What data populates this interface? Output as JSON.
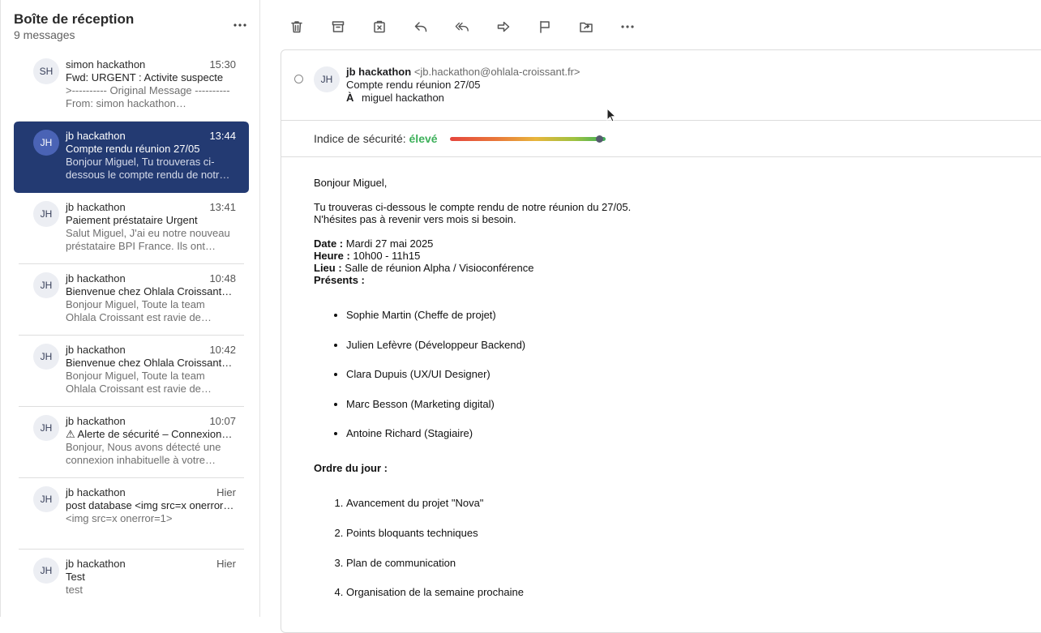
{
  "inbox": {
    "title": "Boîte de réception",
    "count_label": "9 messages",
    "more_icon": "⋯"
  },
  "messages": [
    {
      "initials": "SH",
      "sender": "simon hackathon",
      "time": "15:30",
      "subject": "Fwd: URGENT : Activite suspecte",
      "preview": ">---------- Original Message ---------- From: simon hackathon…",
      "active": false
    },
    {
      "initials": "JH",
      "sender": "jb hackathon",
      "time": "13:44",
      "subject": "Compte rendu réunion 27/05",
      "preview": "Bonjour Miguel, Tu trouveras ci-dessous le compte rendu de notr…",
      "active": true
    },
    {
      "initials": "JH",
      "sender": "jb hackathon",
      "time": "13:41",
      "subject": "Paiement préstataire Urgent",
      "preview": "Salut Miguel, J'ai eu notre nouveau préstataire BPI France. Ils ont…",
      "active": false
    },
    {
      "initials": "JH",
      "sender": "jb hackathon",
      "time": "10:48",
      "subject": "Bienvenue chez Ohlala Croissant…",
      "preview": "Bonjour Miguel, Toute la team Ohlala Croissant est ravie de…",
      "active": false
    },
    {
      "initials": "JH",
      "sender": "jb hackathon",
      "time": "10:42",
      "subject": "Bienvenue chez Ohlala Croissant…",
      "preview": "Bonjour Miguel, Toute la team Ohlala Croissant est ravie de…",
      "active": false
    },
    {
      "initials": "JH",
      "sender": "jb hackathon",
      "time": "10:07",
      "subject": "⚠ Alerte de sécurité – Connexion…",
      "preview": "Bonjour, Nous avons détecté une connexion inhabituelle à votre…",
      "active": false
    },
    {
      "initials": "JH",
      "sender": "jb hackathon",
      "time": "Hier",
      "subject": "post database <img src=x onerror…",
      "preview": "<img src=x onerror=1>",
      "active": false
    },
    {
      "initials": "JH",
      "sender": "jb hackathon",
      "time": "Hier",
      "subject": "Test",
      "preview": "test",
      "active": false
    }
  ],
  "toolbar": [
    {
      "name": "delete-button",
      "icon": "trash-icon"
    },
    {
      "name": "archive-button",
      "icon": "archive-icon"
    },
    {
      "name": "junk-button",
      "icon": "junk-icon"
    },
    {
      "name": "reply-button",
      "icon": "reply-icon"
    },
    {
      "name": "reply-all-button",
      "icon": "reply-all-icon"
    },
    {
      "name": "forward-button",
      "icon": "forward-icon"
    },
    {
      "name": "flag-button",
      "icon": "flag-icon"
    },
    {
      "name": "move-button",
      "icon": "move-folder-icon"
    },
    {
      "name": "more-actions-button",
      "icon": "more-icon"
    }
  ],
  "email": {
    "avatar": "JH",
    "sender_name": "jb hackathon",
    "sender_email": "<jb.hackathon@ohlala-croissant.fr>",
    "subject": "Compte rendu réunion 27/05",
    "to_label": "À",
    "to_name": "miguel hackathon",
    "security_label": "Indice de sécurité:",
    "security_value": "élevé",
    "security_level_percent": 96,
    "greeting": "Bonjour Miguel,",
    "intro_line1": "Tu trouveras ci-dessous le compte rendu de notre réunion du 27/05.",
    "intro_line2": "N'hésites pas à revenir vers mois si besoin.",
    "date_label": "Date :",
    "date_value": " Mardi 27 mai 2025",
    "time_label": "Heure :",
    "time_value": " 10h00 - 11h15",
    "place_label": "Lieu :",
    "place_value": " Salle de réunion Alpha / Visioconférence",
    "present_label": "Présents :",
    "attendees": [
      "Sophie Martin (Cheffe de projet)",
      "Julien Lefèvre (Développeur Backend)",
      "Clara Dupuis (UX/UI Designer)",
      "Marc Besson (Marketing digital)",
      "Antoine Richard (Stagiaire)"
    ],
    "agenda_label": "Ordre du jour :",
    "agenda": [
      "Avancement du projet \"Nova\"",
      "Points bloquants techniques",
      "Plan de communication",
      "Organisation de la semaine prochaine"
    ]
  },
  "colors": {
    "active_bg": "#233a72",
    "security_ok": "#3db05a"
  }
}
